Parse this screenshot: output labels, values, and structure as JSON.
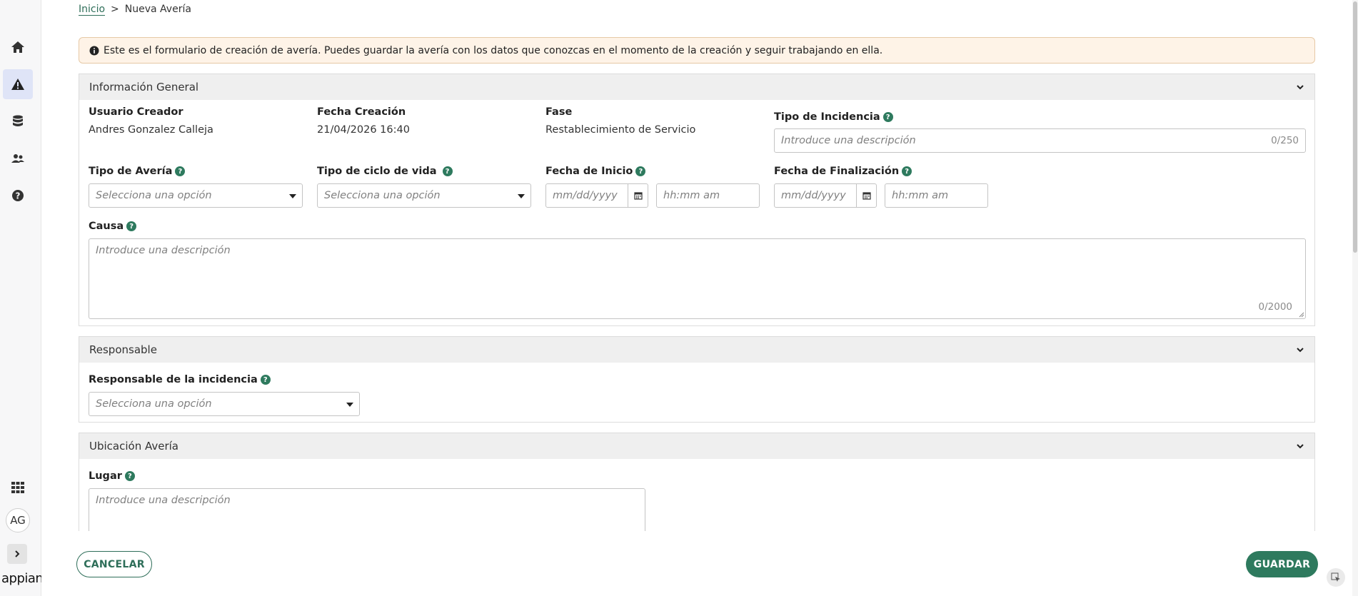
{
  "sidebar": {
    "items": [
      {
        "name": "home",
        "icon": "home-icon"
      },
      {
        "name": "alerts",
        "icon": "warning-icon"
      },
      {
        "name": "data",
        "icon": "database-icon"
      },
      {
        "name": "users",
        "icon": "users-icon"
      },
      {
        "name": "help",
        "icon": "help-circle-icon"
      }
    ],
    "apps_icon": "grid-icon",
    "avatar_initials": "AG",
    "expand_icon": "chevron-right-icon",
    "logo_text": "appian"
  },
  "breadcrumb": {
    "home": "Inicio",
    "separator": ">",
    "current": "Nueva Avería"
  },
  "banner": {
    "icon": "info-icon",
    "text": "Este es el formulario de creación de avería. Puedes guardar la avería con los datos que conozcas en el momento de la creación y seguir trabajando en ella."
  },
  "general": {
    "title": "Información General",
    "creator_label": "Usuario Creador",
    "creator_value": "Andres Gonzalez Calleja",
    "created_label": "Fecha Creación",
    "created_value": "21/04/2026 16:40",
    "phase_label": "Fase",
    "phase_value": "Restablecimiento de Servicio",
    "incident_type_label": "Tipo de Incidencia",
    "incident_type_placeholder": "Introduce una descripción",
    "incident_type_counter": "0/250",
    "fault_type_label": "Tipo de Avería",
    "fault_type_placeholder": "Selecciona una opción",
    "lifecycle_label": "Tipo de ciclo de vida",
    "lifecycle_placeholder": "Selecciona una opción",
    "start_label": "Fecha de Inicio",
    "start_date_placeholder": "mm/dd/yyyy",
    "start_time_placeholder": "hh:mm am",
    "end_label": "Fecha de Finalización",
    "end_date_placeholder": "mm/dd/yyyy",
    "end_time_placeholder": "hh:mm am",
    "cause_label": "Causa",
    "cause_placeholder": "Introduce una descripción",
    "cause_counter": "0/2000"
  },
  "responsible": {
    "title": "Responsable",
    "field_label": "Responsable de la incidencia",
    "field_placeholder": "Selecciona una opción"
  },
  "location": {
    "title": "Ubicación Avería",
    "place_label": "Lugar",
    "place_placeholder": "Introduce una descripción"
  },
  "actions": {
    "cancel": "CANCELAR",
    "save": "GUARDAR"
  },
  "colors": {
    "accent": "#2e7a5e",
    "banner_bg": "#fef3e7",
    "section_header_bg": "#efefef",
    "active_nav_bg": "#dfe4f7"
  }
}
